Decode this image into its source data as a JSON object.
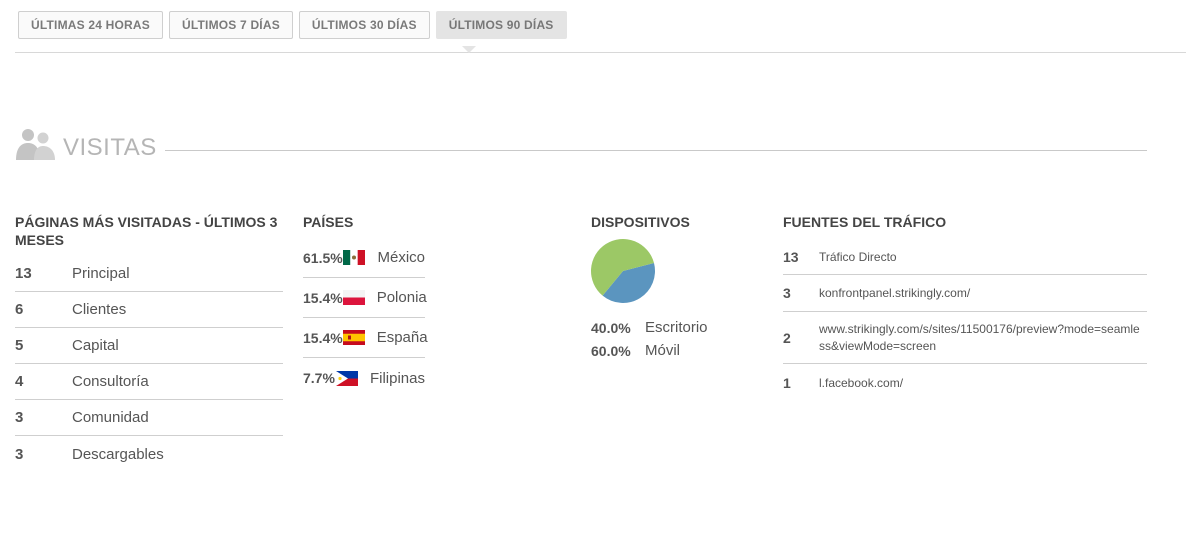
{
  "tabs": [
    {
      "label": "ÚLTIMAS 24 HORAS",
      "active": false
    },
    {
      "label": "ÚLTIMOS 7 DÍAS",
      "active": false
    },
    {
      "label": "ÚLTIMOS 30 DÍAS",
      "active": false
    },
    {
      "label": "ÚLTIMOS 90 DÍAS",
      "active": true
    }
  ],
  "section": {
    "title": "VISITAS",
    "icon": "people-icon"
  },
  "pages": {
    "title": "PÁGINAS MÁS VISITADAS - ÚLTIMOS 3 MESES",
    "rows": [
      {
        "count": "13",
        "name": "Principal"
      },
      {
        "count": "6",
        "name": "Clientes"
      },
      {
        "count": "5",
        "name": "Capital"
      },
      {
        "count": "4",
        "name": "Consultoría"
      },
      {
        "count": "3",
        "name": "Comunidad"
      },
      {
        "count": "3",
        "name": "Descargables"
      }
    ]
  },
  "countries": {
    "title": "PAÍSES",
    "rows": [
      {
        "percent": "61.5%",
        "name": "México",
        "flag": "mexico-flag-icon"
      },
      {
        "percent": "15.4%",
        "name": "Polonia",
        "flag": "poland-flag-icon"
      },
      {
        "percent": "15.4%",
        "name": "España",
        "flag": "spain-flag-icon"
      },
      {
        "percent": "7.7%",
        "name": "Filipinas",
        "flag": "philippines-flag-icon"
      }
    ]
  },
  "devices": {
    "title": "DISPOSITIVOS",
    "rows": [
      {
        "percent": "40.0%",
        "name": "Escritorio",
        "value": 40,
        "color": "#5b95bf"
      },
      {
        "percent": "60.0%",
        "name": "Móvil",
        "value": 60,
        "color": "#9cc866"
      }
    ]
  },
  "sources": {
    "title": "FUENTES DEL TRÁFICO",
    "rows": [
      {
        "count": "13",
        "name": "Tráfico Directo"
      },
      {
        "count": "3",
        "name": "konfrontpanel.strikingly.com/"
      },
      {
        "count": "2",
        "name": "www.strikingly.com/s/sites/11500176/preview?mode=seamless&viewMode=screen"
      },
      {
        "count": "1",
        "name": "l.facebook.com/"
      }
    ]
  },
  "colors": {
    "mexico_green": "#006847",
    "mexico_red": "#ce1126",
    "poland_red": "#dc143c",
    "spain_red": "#c60b1e",
    "spain_yellow": "#ffc400",
    "ph_blue": "#0038a8",
    "ph_red": "#ce1126",
    "ph_yellow": "#fcd116"
  }
}
